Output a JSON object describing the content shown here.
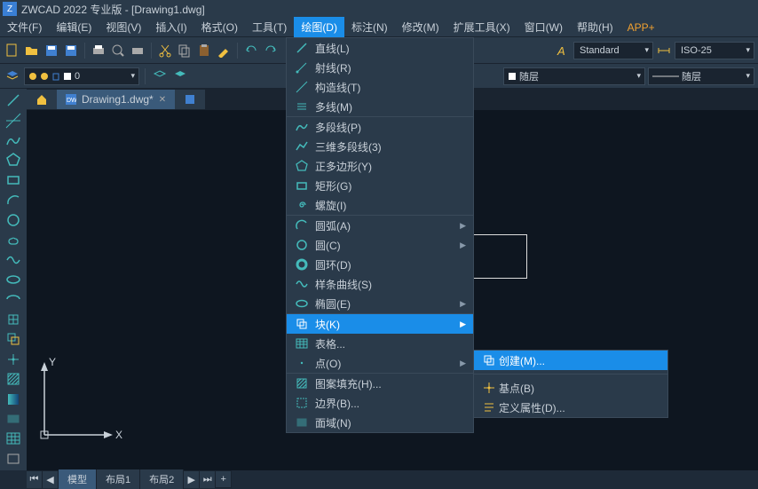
{
  "title": "ZWCAD 2022 专业版 - [Drawing1.dwg]",
  "menubar": [
    "文件(F)",
    "编辑(E)",
    "视图(V)",
    "插入(I)",
    "格式(O)",
    "工具(T)",
    "绘图(D)",
    "标注(N)",
    "修改(M)",
    "扩展工具(X)",
    "窗口(W)",
    "帮助(H)",
    "APP+"
  ],
  "menubar_active": 6,
  "layer_value": "0",
  "style_a": "Standard",
  "style_b": "ISO-25",
  "prop1": "随层",
  "prop2": "随层",
  "tab_name": "Drawing1.dwg*",
  "x_label": "X",
  "y_label": "Y",
  "draw_menu": [
    [
      {
        "icon": "line",
        "label": "直线(L)"
      },
      {
        "icon": "ray",
        "label": "射线(R)"
      },
      {
        "icon": "xline",
        "label": "构造线(T)"
      },
      {
        "icon": "mline",
        "label": "多线(M)"
      }
    ],
    [
      {
        "icon": "pline",
        "label": "多段线(P)"
      },
      {
        "icon": "3dpoly",
        "label": "三维多段线(3)"
      },
      {
        "icon": "polygon",
        "label": "正多边形(Y)"
      },
      {
        "icon": "rect",
        "label": "矩形(G)"
      },
      {
        "icon": "spiral",
        "label": "螺旋(I)"
      }
    ],
    [
      {
        "icon": "arc",
        "label": "圆弧(A)",
        "sub": true
      },
      {
        "icon": "circle",
        "label": "圆(C)",
        "sub": true
      },
      {
        "icon": "donut",
        "label": "圆环(D)"
      },
      {
        "icon": "spline",
        "label": "样条曲线(S)"
      },
      {
        "icon": "ellipse",
        "label": "椭圆(E)",
        "sub": true
      }
    ],
    [
      {
        "icon": "block",
        "label": "块(K)",
        "sub": true,
        "hl": true
      },
      {
        "icon": "table",
        "label": "表格..."
      },
      {
        "icon": "point",
        "label": "点(O)",
        "sub": true
      }
    ],
    [
      {
        "icon": "hatch",
        "label": "图案填充(H)..."
      },
      {
        "icon": "boundary",
        "label": "边界(B)..."
      },
      {
        "icon": "region",
        "label": "面域(N)"
      }
    ]
  ],
  "submenu": [
    {
      "icon": "create",
      "label": "创建(M)...",
      "hl": true
    },
    {
      "icon": "base",
      "label": "基点(B)"
    },
    {
      "icon": "attdef",
      "label": "定义属性(D)..."
    }
  ],
  "bottom_tabs": [
    "模型",
    "布局1",
    "布局2"
  ]
}
